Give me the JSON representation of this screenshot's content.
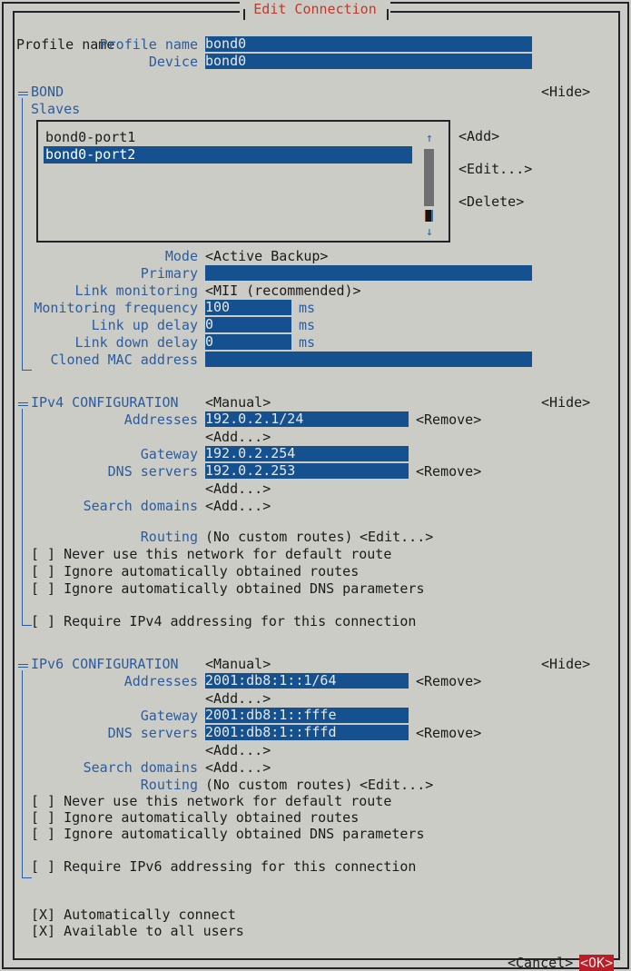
{
  "window": {
    "title": "Edit Connection"
  },
  "general": {
    "profile_name_label": "Profile name",
    "profile_name_value": "bond0",
    "profile_name_fill": "______________________________________",
    "device_label": "Device",
    "device_value": "bond0",
    "device_fill": "______________________________________"
  },
  "bond": {
    "section_label": "BOND",
    "hide_label": "<Hide>",
    "slaves_label": "Slaves",
    "slaves": [
      {
        "name": "bond0-port1",
        "selected": false
      },
      {
        "name": "bond0-port2",
        "selected": true
      }
    ],
    "add_button": "<Add>",
    "edit_button": "<Edit...>",
    "delete_button": "<Delete>",
    "scroll_up_icon": "↑",
    "scroll_down_icon": "↓",
    "mode_label": "Mode",
    "mode_value": "<Active Backup>",
    "primary_label": "Primary",
    "primary_value": "",
    "primary_fill": "                                      ",
    "link_monitoring_label": "Link monitoring",
    "link_monitoring_value": "<MII (recommended)>",
    "monitoring_frequency_label": "Monitoring frequency",
    "monitoring_frequency_value": "100",
    "monitoring_frequency_fill": "______",
    "monitoring_frequency_unit": "ms",
    "link_up_delay_label": "Link up delay",
    "link_up_delay_value": "0",
    "link_up_delay_fill": "________",
    "link_up_delay_unit": "ms",
    "link_down_delay_label": "Link down delay",
    "link_down_delay_value": "0",
    "link_down_delay_fill": "________",
    "link_down_delay_unit": "ms",
    "cloned_mac_label": "Cloned MAC address",
    "cloned_mac_value": "",
    "cloned_mac_fill": "                                      "
  },
  "ipv4": {
    "section_label": "IPv4 CONFIGURATION",
    "method_value": "<Manual>",
    "hide_label": "<Hide>",
    "addresses_label": "Addresses",
    "addresses_value": "192.0.2.1/24",
    "addresses_fill": "____________",
    "addresses_remove": "<Remove>",
    "addresses_add": "<Add...>",
    "gateway_label": "Gateway",
    "gateway_value": "192.0.2.254",
    "gateway_fill": "_____________",
    "dns_label": "DNS servers",
    "dns_value": "192.0.2.253",
    "dns_fill": "_____________",
    "dns_remove": "<Remove>",
    "dns_add": "<Add...>",
    "search_domains_label": "Search domains",
    "search_domains_add": "<Add...>",
    "routing_label": "Routing",
    "routing_value": "(No custom routes)",
    "routing_edit": "<Edit...>",
    "checkboxes": [
      {
        "mark": "[ ]",
        "label": "Never use this network for default route"
      },
      {
        "mark": "[ ]",
        "label": "Ignore automatically obtained routes"
      },
      {
        "mark": "[ ]",
        "label": "Ignore automatically obtained DNS parameters"
      }
    ],
    "require_checkbox": {
      "mark": "[ ]",
      "label": "Require IPv4 addressing for this connection"
    }
  },
  "ipv6": {
    "section_label": "IPv6 CONFIGURATION",
    "method_value": "<Manual>",
    "hide_label": "<Hide>",
    "addresses_label": "Addresses",
    "addresses_value": "2001:db8:1::1/64",
    "addresses_fill": "________",
    "addresses_remove": "<Remove>",
    "addresses_add": "<Add...>",
    "gateway_label": "Gateway",
    "gateway_value": "2001:db8:1::fffe",
    "gateway_fill": "________",
    "dns_label": "DNS servers",
    "dns_value": "2001:db8:1::fffd",
    "dns_fill": "________",
    "dns_remove": "<Remove>",
    "dns_add": "<Add...>",
    "search_domains_label": "Search domains",
    "search_domains_add": "<Add...>",
    "routing_label": "Routing",
    "routing_value": "(No custom routes)",
    "routing_edit": "<Edit...>",
    "checkboxes": [
      {
        "mark": "[ ]",
        "label": "Never use this network for default route"
      },
      {
        "mark": "[ ]",
        "label": "Ignore automatically obtained routes"
      },
      {
        "mark": "[ ]",
        "label": "Ignore automatically obtained DNS parameters"
      }
    ],
    "require_checkbox": {
      "mark": "[ ]",
      "label": "Require IPv6 addressing for this connection"
    }
  },
  "footer": {
    "auto_connect": {
      "mark": "[X]",
      "label": "Automatically connect"
    },
    "all_users": {
      "mark": "[X]",
      "label": "Available to all users"
    },
    "cancel_button": "<Cancel>",
    "ok_button": "<OK>"
  },
  "colors": {
    "background": "#ccccc7",
    "field_blue": "#15508f",
    "label_blue": "#2c5c9e",
    "title_red": "#c0392b",
    "ok_red": "#bd1c26",
    "border_dark": "#22222a",
    "scroll_thumb": "#6e6e73"
  }
}
